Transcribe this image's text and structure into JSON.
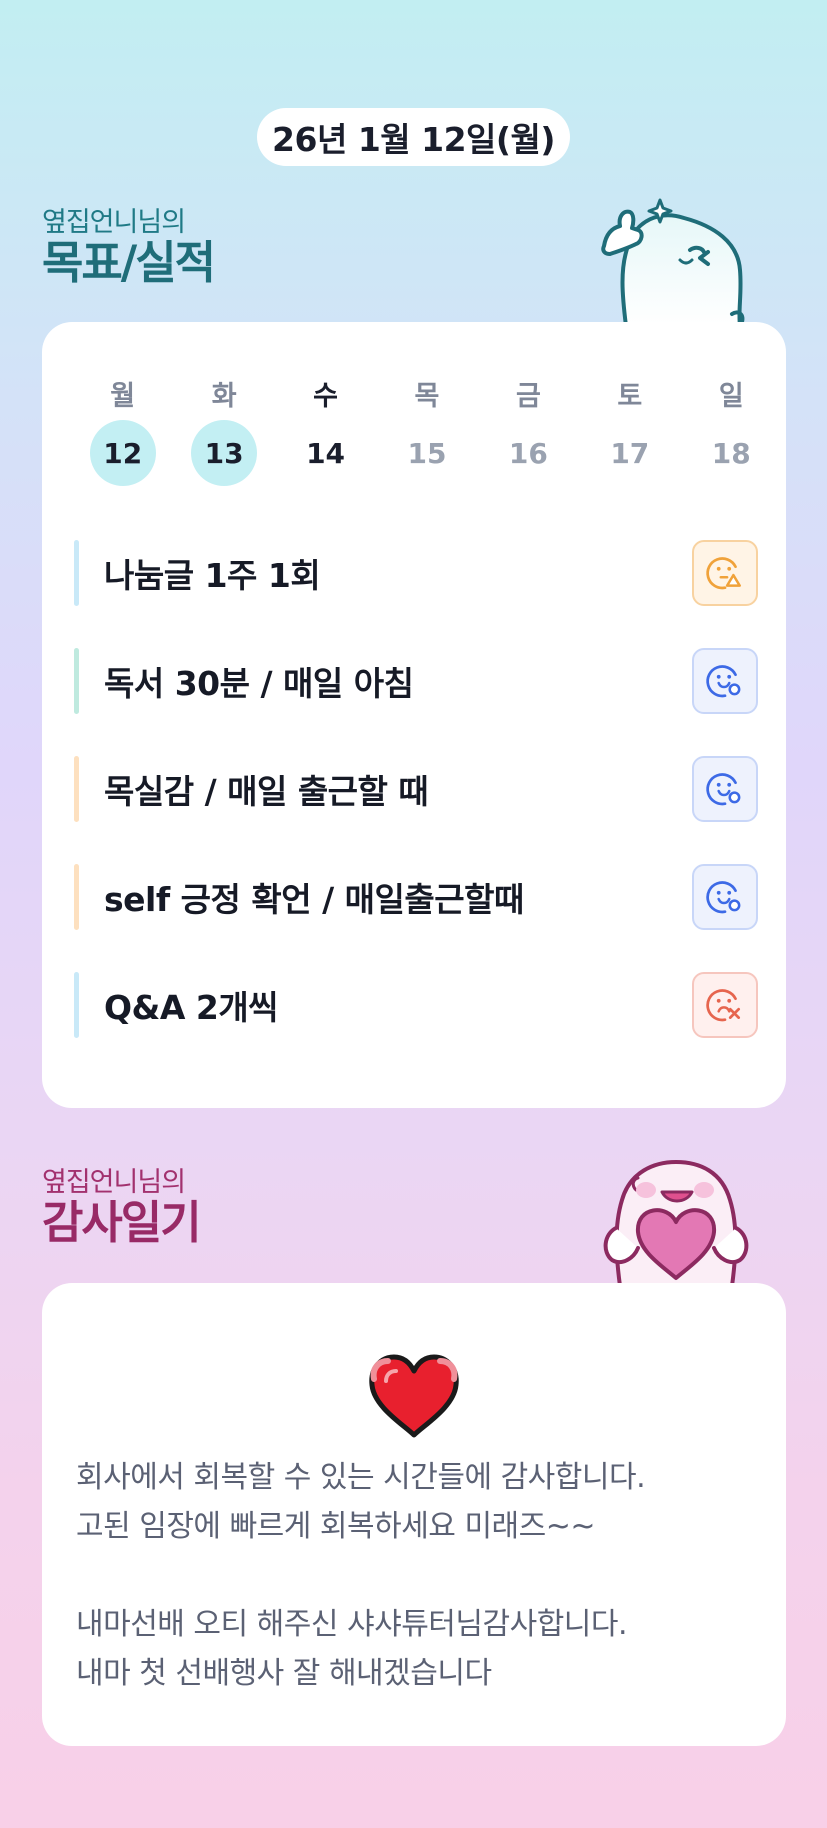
{
  "date_label": "26년 1월 12일(월)",
  "goals_section": {
    "subtitle": "옆집언니님의",
    "title": "목표/실적"
  },
  "week": {
    "days": [
      {
        "day": "월",
        "date": "12",
        "state": "done"
      },
      {
        "day": "화",
        "date": "13",
        "state": "done"
      },
      {
        "day": "수",
        "date": "14",
        "state": "today"
      },
      {
        "day": "목",
        "date": "15",
        "state": "future"
      },
      {
        "day": "금",
        "date": "16",
        "state": "future"
      },
      {
        "day": "토",
        "date": "17",
        "state": "future"
      },
      {
        "day": "일",
        "date": "18",
        "state": "future"
      }
    ]
  },
  "goals": [
    {
      "text": "나눔글 1주 1회",
      "status": "warn",
      "bar_color": "#c9e9f8",
      "status_icon": "smile-triangle-icon"
    },
    {
      "text": "독서 30분 / 매일 아침",
      "status": "ok",
      "bar_color": "#bfeadf",
      "status_icon": "smile-circle-icon"
    },
    {
      "text": "목실감 / 매일 출근할 때",
      "status": "ok",
      "bar_color": "#fde0bf",
      "status_icon": "smile-circle-icon"
    },
    {
      "text": "self 긍정 확언 / 매일출근할때",
      "status": "ok",
      "bar_color": "#fde0bf",
      "status_icon": "smile-circle-icon"
    },
    {
      "text": "Q&A 2개씩",
      "status": "fail",
      "bar_color": "#c9e9f8",
      "status_icon": "frown-x-icon"
    }
  ],
  "thanks_section": {
    "subtitle": "옆집언니님의",
    "title": "감사일기",
    "text": "회사에서 회복할 수 있는 시간들에 감사합니다.\n고된 임장에 빠르게 회복하세요 미래즈~~\n\n내마선배 오티 해주신 샤샤튜터님감사합니다.\n내마 첫 선배행사 잘 해내겠습니다"
  },
  "colors": {
    "done_circle": "#c3eff3",
    "warn": "#f0a23a",
    "ok": "#3d6ae6",
    "fail": "#e6654e"
  }
}
